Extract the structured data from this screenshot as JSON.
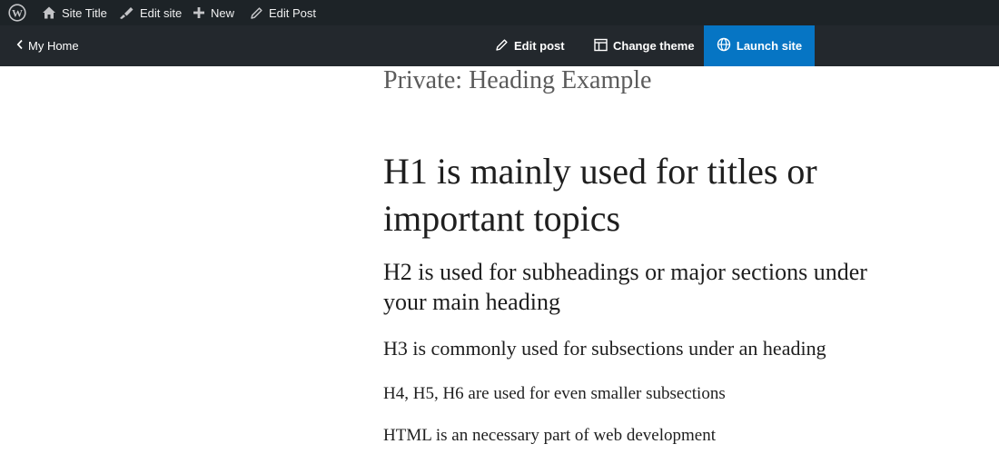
{
  "adminbar": {
    "logo_icon": "wordpress-logo-icon",
    "site_title": "Site Title",
    "edit_site": "Edit site",
    "new": "New",
    "edit_post": "Edit Post"
  },
  "subbar": {
    "my_home": "My Home",
    "edit_post": "Edit post",
    "change_theme": "Change theme",
    "launch_site": "Launch site",
    "launch_color": "#0675c4"
  },
  "content": {
    "post_title": "Private: Heading Example",
    "h1": "H1 is mainly used for titles or important topics",
    "h2": "H2 is used for subheadings or major sections under your main heading",
    "h3": "H3 is commonly used for subsections under an heading",
    "h4": "H4, H5, H6 are used for even smaller subsections",
    "paragraph": "HTML is an necessary part of web development"
  }
}
